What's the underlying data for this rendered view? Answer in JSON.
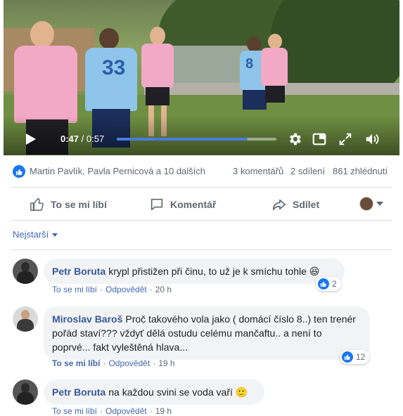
{
  "video": {
    "current_time": "0:47",
    "total_time": " / 0:57",
    "progress": 0.82,
    "jersey_number_left": "33",
    "jersey_number_right": "8"
  },
  "stats": {
    "likers": "Martin Pavlík, Pavla Pernicová a 10 dalších",
    "comments": "3 komentářů",
    "shares": "2 sdílení",
    "views": "861 zhlédnutí"
  },
  "actions": {
    "like": "To se mi líbí",
    "comment": "Komentář",
    "share": "Sdílet"
  },
  "sort_label": "Nejstarší",
  "comments": [
    {
      "author": "Petr Boruta",
      "text": "krypl přistižen při činu, to už je k smíchu tohle 😆",
      "reactions": "2",
      "like_label": "To se mi líbí",
      "reply_label": "Odpovědět",
      "time": "20 h"
    },
    {
      "author": "Miroslav Baroš",
      "text": "Proč takového vola jako ( domácí číslo 8..) ten trenér pořád staví??? vždyť dělá ostudu celému mančaftu.. a není to poprvé... fakt vyleštěná hlava...",
      "reactions": "12",
      "like_label": "To se mi líbí",
      "reply_label": "Odpovědět",
      "time": "19 h"
    },
    {
      "author": "Petr Boruta",
      "text": "na každou svini se voda vaří 🙂",
      "reactions": "",
      "like_label": "To se mi líbí",
      "reply_label": "Odpovědět",
      "time": "19 h"
    }
  ],
  "colors": {
    "accent": "#1877f2",
    "link": "#385898",
    "progress": "#4a7be0"
  }
}
